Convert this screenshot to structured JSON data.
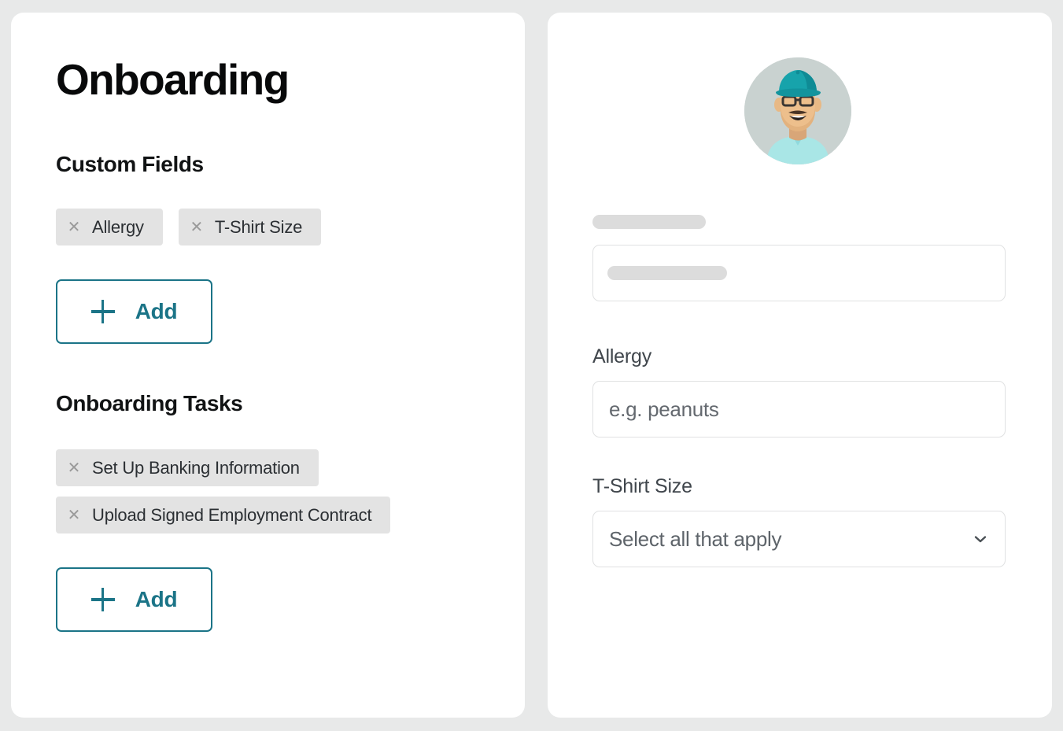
{
  "theme": {
    "page_background": "#e8e9e9",
    "card_background": "#ffffff",
    "accent_teal": "#1b7487",
    "chip_background": "#e3e3e3",
    "skeleton_gray": "#dcdcdc",
    "input_border": "#e0e1e2",
    "avatar_cap_color": "#17a3ab",
    "avatar_shirt_color": "#a9e6e6",
    "avatar_bg_color": "#c9d2d0"
  },
  "left_panel": {
    "page_title": "Onboarding",
    "custom_fields": {
      "heading": "Custom Fields",
      "chips": [
        {
          "remove_icon": "close-icon",
          "label": "Allergy"
        },
        {
          "remove_icon": "close-icon",
          "label": "T-Shirt Size"
        }
      ],
      "add_button": {
        "icon": "plus-icon",
        "label": "Add"
      }
    },
    "onboarding_tasks": {
      "heading": "Onboarding Tasks",
      "chips": [
        {
          "remove_icon": "close-icon",
          "label": "Set Up Banking Information"
        },
        {
          "remove_icon": "close-icon",
          "label": "Upload Signed Employment Contract"
        }
      ],
      "add_button": {
        "icon": "plus-icon",
        "label": "Add"
      }
    }
  },
  "right_panel": {
    "avatar": {
      "icon": "user-avatar-illustration",
      "alt": "Person wearing teal cap and glasses"
    },
    "skeleton_field": {
      "label_placeholder": "",
      "value_placeholder": ""
    },
    "fields": [
      {
        "label": "Allergy",
        "type": "text",
        "value": "",
        "placeholder": "e.g. peanuts"
      },
      {
        "label": "T-Shirt Size",
        "type": "select",
        "value": "Select all that apply",
        "chevron_icon": "chevron-down-icon"
      }
    ]
  }
}
